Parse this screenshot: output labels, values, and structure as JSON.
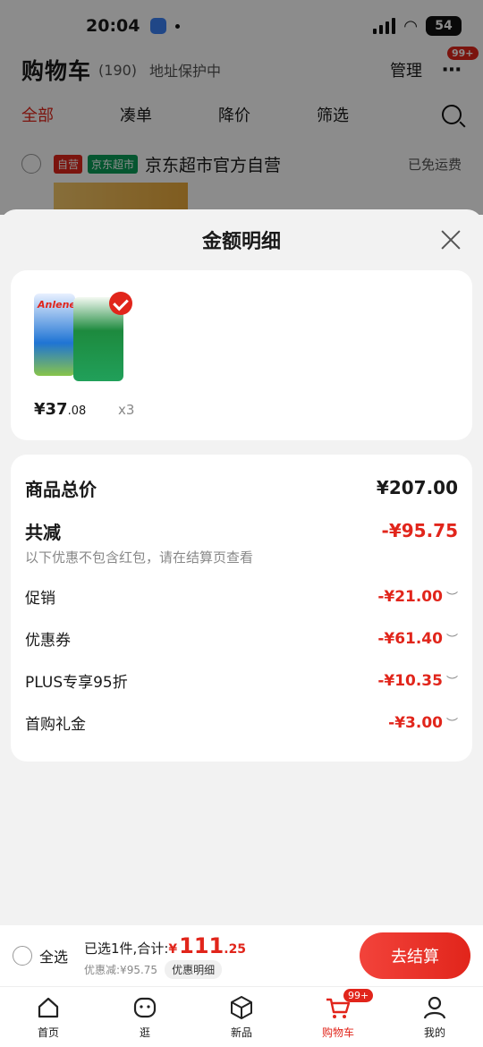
{
  "status": {
    "time": "20:04",
    "battery": "54"
  },
  "header": {
    "title": "购物车",
    "count": "(190)",
    "address": "地址保护中",
    "manage": "管理",
    "badge": "99+"
  },
  "filters": [
    {
      "label": "全部",
      "active": true
    },
    {
      "label": "凑单",
      "active": false
    },
    {
      "label": "降价",
      "active": false
    },
    {
      "label": "筛选",
      "active": false
    }
  ],
  "store": {
    "tag_self": "自营",
    "tag_market": "京东超市",
    "name": "京东超市官方自营",
    "free_ship": "已免运费"
  },
  "sheet": {
    "title": "金额明细",
    "product": {
      "brand": "Anlene",
      "price_int": "¥37",
      "price_dec": ".08",
      "qty": "x3"
    },
    "total_label": "商品总价",
    "total_value": "¥207.00",
    "reduce_label": "共减",
    "reduce_value": "-¥95.75",
    "note": "以下优惠不包含红包，请在结算页查看",
    "items": [
      {
        "label": "促销",
        "value": "-¥21.00"
      },
      {
        "label": "优惠券",
        "value": "-¥61.40"
      },
      {
        "label": "PLUS专享95折",
        "value": "-¥10.35"
      },
      {
        "label": "首购礼金",
        "value": "-¥3.00"
      }
    ]
  },
  "checkout": {
    "select_all": "全选",
    "selected": "已选1件,合计:",
    "yen": "¥",
    "amount_int": "111",
    "amount_dec": ".25",
    "discount": "优惠减:¥95.75",
    "detail_btn": "优惠明细",
    "pay": "去结算"
  },
  "tabbar": [
    {
      "label": "首页",
      "icon": "home-icon",
      "active": false
    },
    {
      "label": "逛",
      "icon": "browse-icon",
      "active": false
    },
    {
      "label": "新品",
      "icon": "cube-icon",
      "active": false
    },
    {
      "label": "购物车",
      "icon": "cart-icon",
      "active": true,
      "badge": "99+"
    },
    {
      "label": "我的",
      "icon": "profile-icon",
      "active": false
    }
  ],
  "colors": {
    "accent": "#e1251b",
    "market_green": "#0a9d58"
  }
}
